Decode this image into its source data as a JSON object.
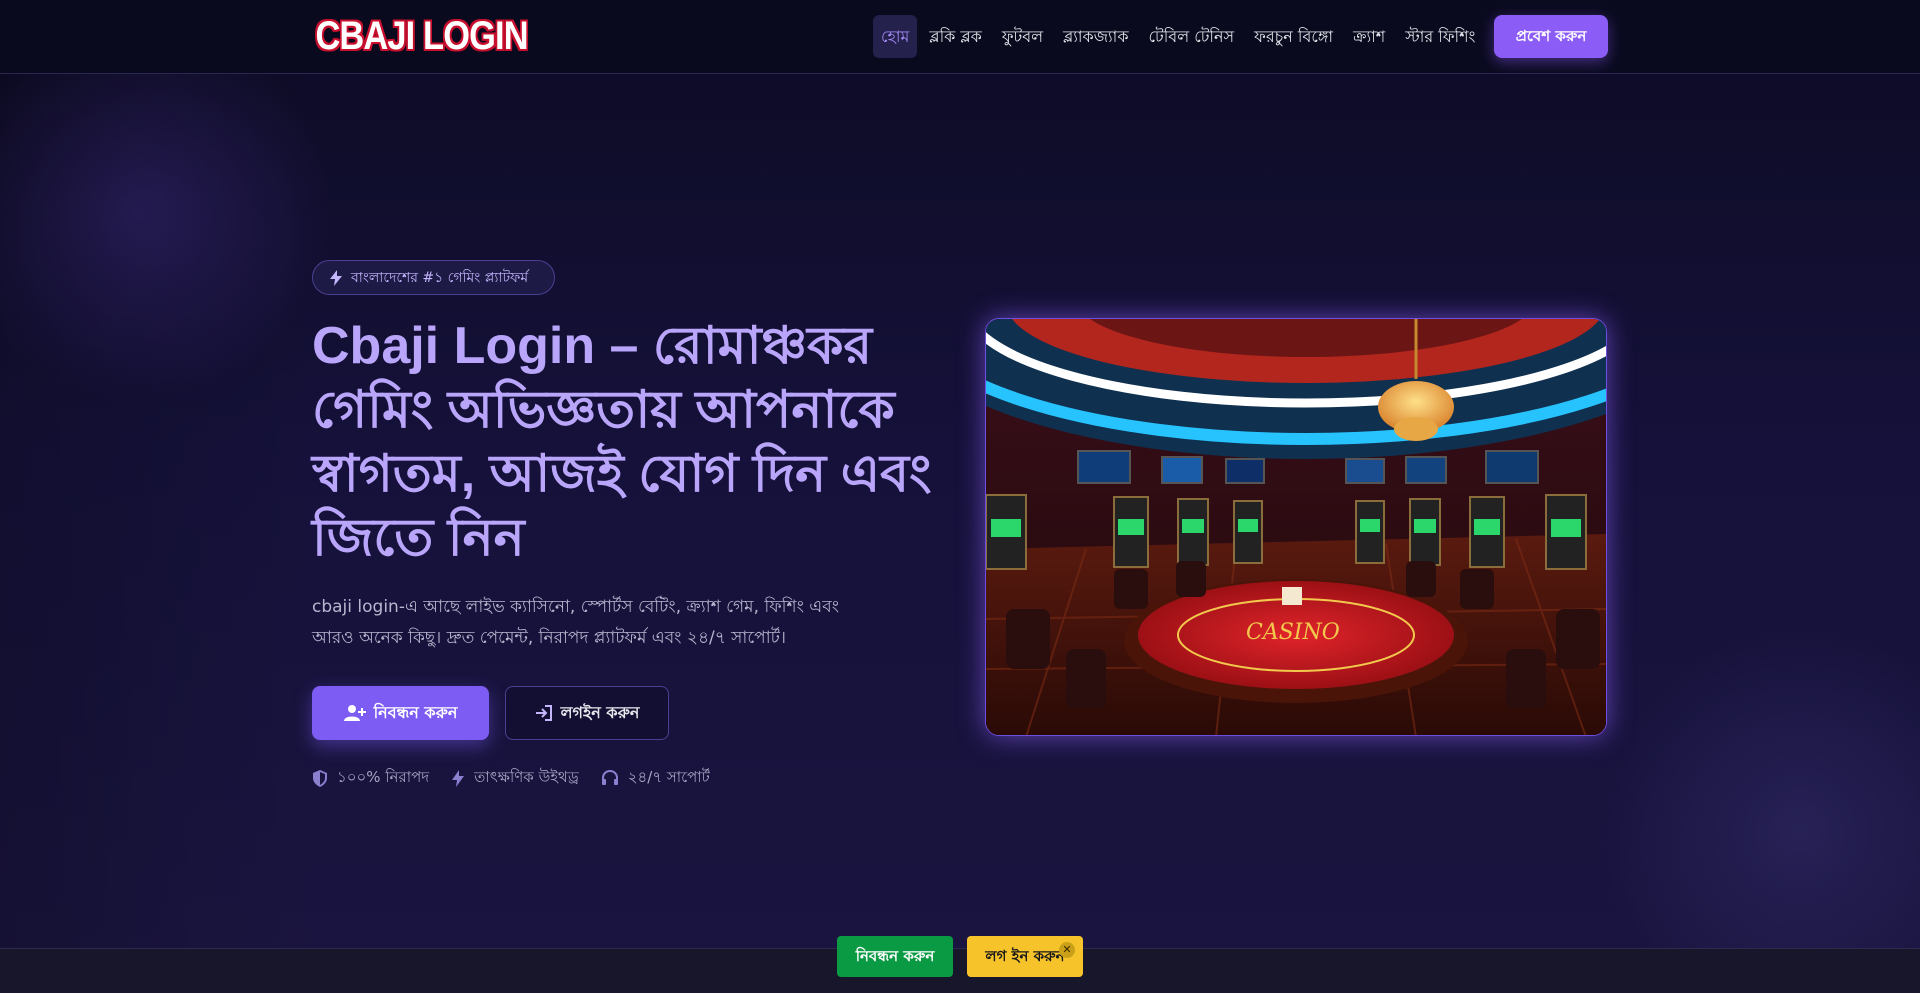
{
  "header": {
    "logo_text": "CBAJI LOGIN",
    "nav": [
      {
        "label": "হোম",
        "active": true
      },
      {
        "label": "ব্লকি ব্লক"
      },
      {
        "label": "ফুটবল"
      },
      {
        "label": "ব্ল্যাকজ্যাক"
      },
      {
        "label": "টেবিল টেনিস"
      },
      {
        "label": "ফরচুন বিঙ্গো"
      },
      {
        "label": "ক্র্যাশ"
      },
      {
        "label": "স্টার ফিশিং"
      }
    ],
    "cta_label": "প্রবেশ করুন"
  },
  "hero": {
    "badge": "বাংলাদেশের #১ গেমিং প্ল্যাটফর্ম",
    "title": "Cbaji Login – রোমাঞ্চকর গেমিং অভিজ্ঞতায় আপনাকে স্বাগতম, আজই যোগ দিন এবং জিতে নিন",
    "description": "cbaji login-এ আছে লাইভ ক্যাসিনো, স্পোর্টস বেটিং, ক্র্যাশ গেম, ফিশিং এবং আরও অনেক কিছু। দ্রুত পেমেন্ট, নিরাপদ প্ল্যাটফর্ম এবং ২৪/৭ সাপোর্ট।",
    "primary_button": "নিবন্ধন করুন",
    "secondary_button": "লগইন করুন",
    "features": [
      {
        "icon": "shield-icon",
        "label": "১০০% নিরাপদ"
      },
      {
        "icon": "bolt-icon",
        "label": "তাৎক্ষণিক উইথড্র"
      },
      {
        "icon": "headset-icon",
        "label": "২৪/৭ সাপোর্ট"
      }
    ]
  },
  "bottom_bar": {
    "register_label": "নিবন্ধন করুন",
    "login_label": "লগ ইন করুন",
    "close_symbol": "✕"
  },
  "colors": {
    "accent": "#8b5cf6",
    "title": "#b9a6fb",
    "green": "#0b9a44",
    "yellow": "#f6c42a"
  }
}
